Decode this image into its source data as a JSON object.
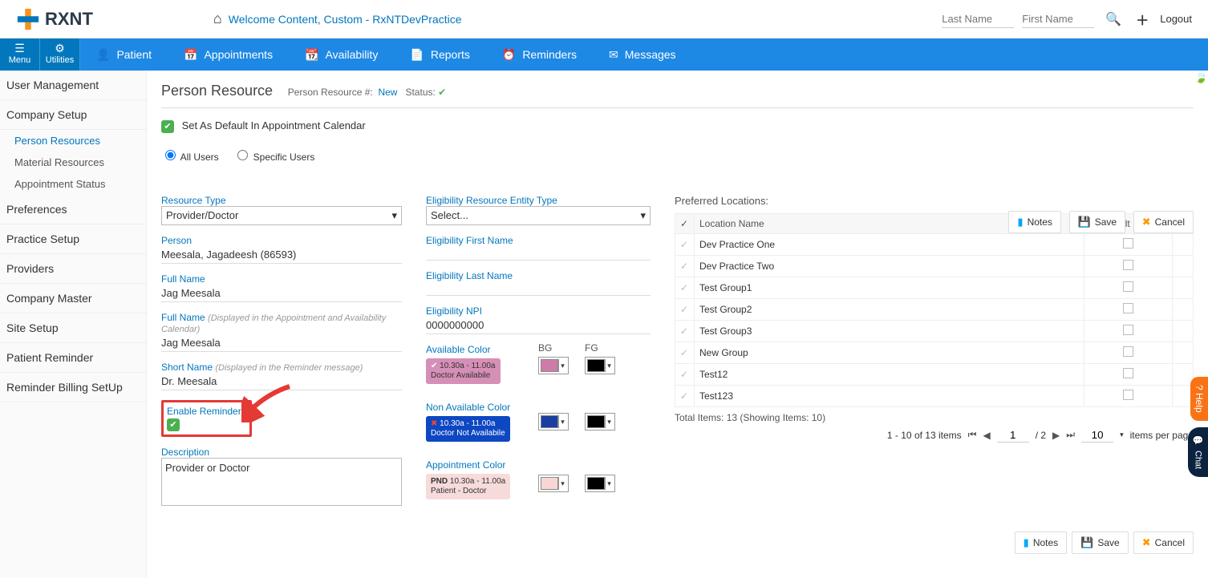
{
  "header": {
    "welcome": "Welcome  Content, Custom - RxNTDevPractice",
    "last_name_ph": "Last Name",
    "first_name_ph": "First Name",
    "logout": "Logout"
  },
  "util": {
    "menu": "Menu",
    "utilities": "Utilities"
  },
  "toolbar": [
    {
      "icon": "👤",
      "label": "Patient"
    },
    {
      "icon": "📅",
      "label": "Appointments"
    },
    {
      "icon": "📆",
      "label": "Availability"
    },
    {
      "icon": "📄",
      "label": "Reports"
    },
    {
      "icon": "⏰",
      "label": "Reminders"
    },
    {
      "icon": "✉",
      "label": "Messages"
    }
  ],
  "sidebar": {
    "groups": [
      {
        "title": "User Management"
      },
      {
        "title": "Company Setup",
        "subs": [
          {
            "label": "Person Resources",
            "active": true
          },
          {
            "label": "Material Resources"
          },
          {
            "label": "Appointment Status"
          }
        ]
      },
      {
        "title": "Preferences"
      },
      {
        "title": "Practice Setup"
      },
      {
        "title": "Providers"
      },
      {
        "title": "Company Master"
      },
      {
        "title": "Site Setup"
      },
      {
        "title": "Patient Reminder"
      },
      {
        "title": "Reminder Billing SetUp"
      }
    ]
  },
  "page": {
    "title": "Person Resource",
    "resnum_label": "Person Resource #:",
    "resnum_val": "New",
    "status_label": "Status:",
    "chk_default": "Set As Default In Appointment Calendar",
    "all_users": "All Users",
    "specific_users": "Specific Users"
  },
  "buttons": {
    "notes": "Notes",
    "save": "Save",
    "cancel": "Cancel"
  },
  "col1": {
    "resource_type_label": "Resource Type",
    "resource_type_val": "Provider/Doctor",
    "person_label": "Person",
    "person_val": "Meesala, Jagadeesh (86593)",
    "full_name_label": "Full Name",
    "full_name_val": "Jag Meesala",
    "full_name2_label": "Full Name",
    "full_name2_hint": "(Displayed in the Appointment and Availability Calendar)",
    "full_name2_val": "Jag Meesala",
    "short_name_label": "Short Name",
    "short_name_hint": "(Displayed in the Reminder message)",
    "short_name_val": "Dr. Meesala",
    "enable_rem_label": "Enable Reminders",
    "description_label": "Description",
    "description_val": "Provider or Doctor"
  },
  "col2": {
    "elig_entity_label": "Eligibility Resource Entity Type",
    "elig_entity_val": "Select...",
    "elig_fn_label": "Eligibility First Name",
    "elig_ln_label": "Eligibility Last Name",
    "elig_npi_label": "Eligibility NPI",
    "elig_npi_val": "0000000000",
    "avail_label": "Available Color",
    "avail_chip_line1": "10.30a - 11.00a",
    "avail_chip_line2": "Doctor Availabile",
    "nonavail_label": "Non Available Color",
    "nonavail_chip_line1": "10.30a - 11.00a",
    "nonavail_chip_line2": "Doctor Not Availabile",
    "appt_label": "Appointment Color",
    "appt_pnd": "PND",
    "appt_chip_line1": "10.30a - 11.00a",
    "appt_chip_line2": "Patient - Doctor",
    "bg": "BG",
    "fg": "FG",
    "colors": {
      "avail_bg": "#cf7ba9",
      "avail_fg": "#000000",
      "nonavail_bg": "#1a3fa0",
      "nonavail_fg": "#000000",
      "appt_bg": "#f8d6d6",
      "appt_fg": "#000000",
      "avail_chip": "#d68fb6",
      "nonavail_chip": "#0d47c2",
      "appt_chip": "#f7dada"
    }
  },
  "col3": {
    "title": "Preferred Locations:",
    "th_name": "Location Name",
    "th_default": "Is Default",
    "rows": [
      {
        "name": "Dev Practice One"
      },
      {
        "name": "Dev Practice Two"
      },
      {
        "name": "Test Group1"
      },
      {
        "name": "Test Group2"
      },
      {
        "name": "Test Group3"
      },
      {
        "name": "New Group"
      },
      {
        "name": "Test12"
      },
      {
        "name": "Test123"
      }
    ],
    "summary": "Total Items: 13 (Showing Items: 10)",
    "pager_range": "1 - 10 of 13 items",
    "pager_page": "1",
    "pager_total": "/ 2",
    "pager_pp": "10",
    "pager_pp_label": "items per page"
  },
  "side": {
    "help": "? Help",
    "chat": "Chat"
  }
}
